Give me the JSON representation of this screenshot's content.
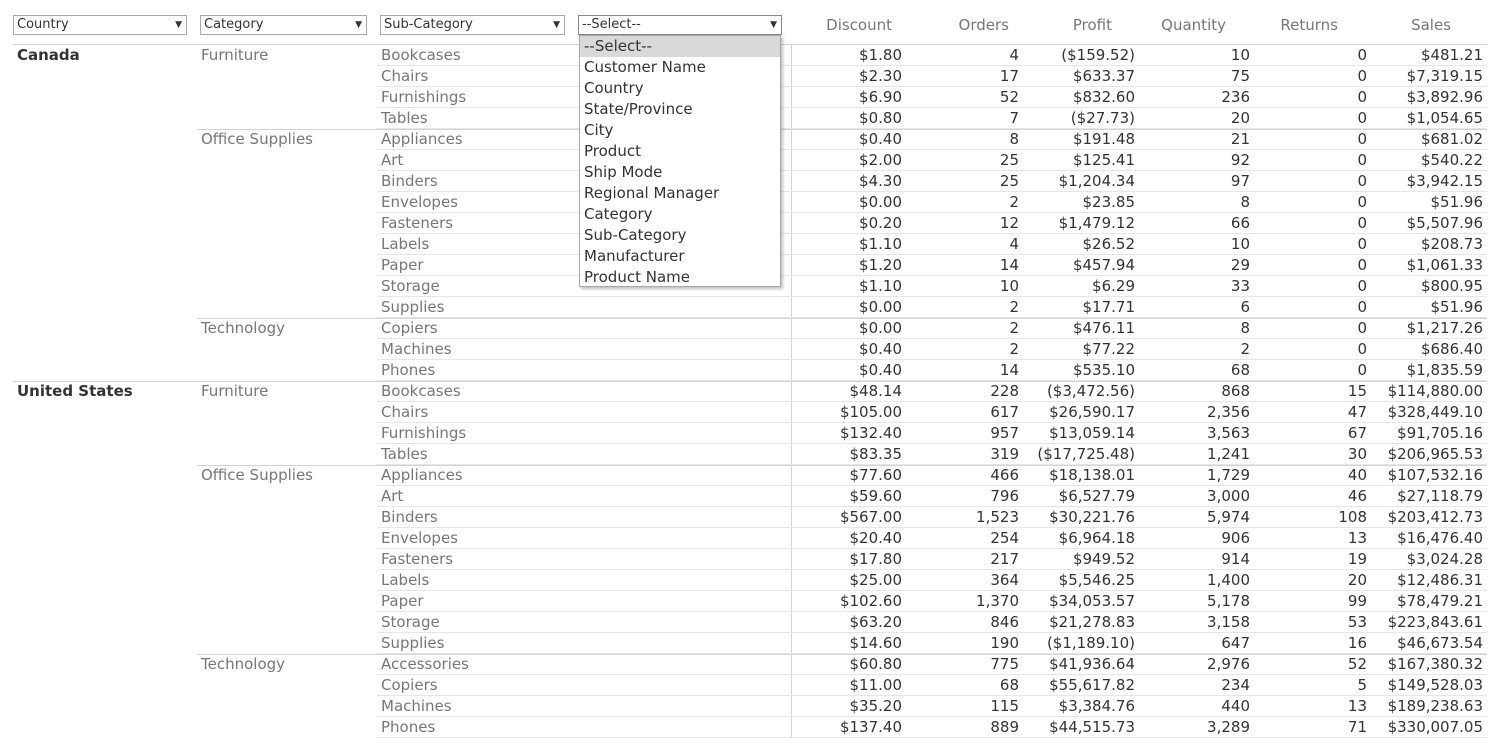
{
  "filters": {
    "country": "Country",
    "category": "Category",
    "sub_category": "Sub-Category",
    "dimension": "--Select--"
  },
  "dropdown_options": [
    "--Select--",
    "Customer Name",
    "Country",
    "State/Province",
    "City",
    "Product",
    "Ship Mode",
    "Regional Manager",
    "Category",
    "Sub-Category",
    "Manufacturer",
    "Product Name"
  ],
  "columns": [
    "Discount",
    "Orders",
    "Profit",
    "Quantity",
    "Returns",
    "Sales"
  ],
  "rows": [
    {
      "country": "Canada",
      "category": "Furniture",
      "sub": "Bookcases",
      "discount": "$1.80",
      "orders": "4",
      "profit": "($159.52)",
      "quantity": "10",
      "returns": "0",
      "sales": "$481.21"
    },
    {
      "country": "",
      "category": "",
      "sub": "Chairs",
      "discount": "$2.30",
      "orders": "17",
      "profit": "$633.37",
      "quantity": "75",
      "returns": "0",
      "sales": "$7,319.15"
    },
    {
      "country": "",
      "category": "",
      "sub": "Furnishings",
      "discount": "$6.90",
      "orders": "52",
      "profit": "$832.60",
      "quantity": "236",
      "returns": "0",
      "sales": "$3,892.96"
    },
    {
      "country": "",
      "category": "",
      "sub": "Tables",
      "discount": "$0.80",
      "orders": "7",
      "profit": "($27.73)",
      "quantity": "20",
      "returns": "0",
      "sales": "$1,054.65"
    },
    {
      "country": "",
      "category": "Office Supplies",
      "sub": "Appliances",
      "discount": "$0.40",
      "orders": "8",
      "profit": "$191.48",
      "quantity": "21",
      "returns": "0",
      "sales": "$681.02"
    },
    {
      "country": "",
      "category": "",
      "sub": "Art",
      "discount": "$2.00",
      "orders": "25",
      "profit": "$125.41",
      "quantity": "92",
      "returns": "0",
      "sales": "$540.22"
    },
    {
      "country": "",
      "category": "",
      "sub": "Binders",
      "discount": "$4.30",
      "orders": "25",
      "profit": "$1,204.34",
      "quantity": "97",
      "returns": "0",
      "sales": "$3,942.15"
    },
    {
      "country": "",
      "category": "",
      "sub": "Envelopes",
      "discount": "$0.00",
      "orders": "2",
      "profit": "$23.85",
      "quantity": "8",
      "returns": "0",
      "sales": "$51.96"
    },
    {
      "country": "",
      "category": "",
      "sub": "Fasteners",
      "discount": "$0.20",
      "orders": "12",
      "profit": "$1,479.12",
      "quantity": "66",
      "returns": "0",
      "sales": "$5,507.96"
    },
    {
      "country": "",
      "category": "",
      "sub": "Labels",
      "discount": "$1.10",
      "orders": "4",
      "profit": "$26.52",
      "quantity": "10",
      "returns": "0",
      "sales": "$208.73"
    },
    {
      "country": "",
      "category": "",
      "sub": "Paper",
      "discount": "$1.20",
      "orders": "14",
      "profit": "$457.94",
      "quantity": "29",
      "returns": "0",
      "sales": "$1,061.33"
    },
    {
      "country": "",
      "category": "",
      "sub": "Storage",
      "discount": "$1.10",
      "orders": "10",
      "profit": "$6.29",
      "quantity": "33",
      "returns": "0",
      "sales": "$800.95"
    },
    {
      "country": "",
      "category": "",
      "sub": "Supplies",
      "discount": "$0.00",
      "orders": "2",
      "profit": "$17.71",
      "quantity": "6",
      "returns": "0",
      "sales": "$51.96"
    },
    {
      "country": "",
      "category": "Technology",
      "sub": "Copiers",
      "discount": "$0.00",
      "orders": "2",
      "profit": "$476.11",
      "quantity": "8",
      "returns": "0",
      "sales": "$1,217.26"
    },
    {
      "country": "",
      "category": "",
      "sub": "Machines",
      "discount": "$0.40",
      "orders": "2",
      "profit": "$77.22",
      "quantity": "2",
      "returns": "0",
      "sales": "$686.40"
    },
    {
      "country": "",
      "category": "",
      "sub": "Phones",
      "discount": "$0.40",
      "orders": "14",
      "profit": "$535.10",
      "quantity": "68",
      "returns": "0",
      "sales": "$1,835.59"
    },
    {
      "country": "United States",
      "category": "Furniture",
      "sub": "Bookcases",
      "discount": "$48.14",
      "orders": "228",
      "profit": "($3,472.56)",
      "quantity": "868",
      "returns": "15",
      "sales": "$114,880.00"
    },
    {
      "country": "",
      "category": "",
      "sub": "Chairs",
      "discount": "$105.00",
      "orders": "617",
      "profit": "$26,590.17",
      "quantity": "2,356",
      "returns": "47",
      "sales": "$328,449.10"
    },
    {
      "country": "",
      "category": "",
      "sub": "Furnishings",
      "discount": "$132.40",
      "orders": "957",
      "profit": "$13,059.14",
      "quantity": "3,563",
      "returns": "67",
      "sales": "$91,705.16"
    },
    {
      "country": "",
      "category": "",
      "sub": "Tables",
      "discount": "$83.35",
      "orders": "319",
      "profit": "($17,725.48)",
      "quantity": "1,241",
      "returns": "30",
      "sales": "$206,965.53"
    },
    {
      "country": "",
      "category": "Office Supplies",
      "sub": "Appliances",
      "discount": "$77.60",
      "orders": "466",
      "profit": "$18,138.01",
      "quantity": "1,729",
      "returns": "40",
      "sales": "$107,532.16"
    },
    {
      "country": "",
      "category": "",
      "sub": "Art",
      "discount": "$59.60",
      "orders": "796",
      "profit": "$6,527.79",
      "quantity": "3,000",
      "returns": "46",
      "sales": "$27,118.79"
    },
    {
      "country": "",
      "category": "",
      "sub": "Binders",
      "discount": "$567.00",
      "orders": "1,523",
      "profit": "$30,221.76",
      "quantity": "5,974",
      "returns": "108",
      "sales": "$203,412.73"
    },
    {
      "country": "",
      "category": "",
      "sub": "Envelopes",
      "discount": "$20.40",
      "orders": "254",
      "profit": "$6,964.18",
      "quantity": "906",
      "returns": "13",
      "sales": "$16,476.40"
    },
    {
      "country": "",
      "category": "",
      "sub": "Fasteners",
      "discount": "$17.80",
      "orders": "217",
      "profit": "$949.52",
      "quantity": "914",
      "returns": "19",
      "sales": "$3,024.28"
    },
    {
      "country": "",
      "category": "",
      "sub": "Labels",
      "discount": "$25.00",
      "orders": "364",
      "profit": "$5,546.25",
      "quantity": "1,400",
      "returns": "20",
      "sales": "$12,486.31"
    },
    {
      "country": "",
      "category": "",
      "sub": "Paper",
      "discount": "$102.60",
      "orders": "1,370",
      "profit": "$34,053.57",
      "quantity": "5,178",
      "returns": "99",
      "sales": "$78,479.21"
    },
    {
      "country": "",
      "category": "",
      "sub": "Storage",
      "discount": "$63.20",
      "orders": "846",
      "profit": "$21,278.83",
      "quantity": "3,158",
      "returns": "53",
      "sales": "$223,843.61"
    },
    {
      "country": "",
      "category": "",
      "sub": "Supplies",
      "discount": "$14.60",
      "orders": "190",
      "profit": "($1,189.10)",
      "quantity": "647",
      "returns": "16",
      "sales": "$46,673.54"
    },
    {
      "country": "",
      "category": "Technology",
      "sub": "Accessories",
      "discount": "$60.80",
      "orders": "775",
      "profit": "$41,936.64",
      "quantity": "2,976",
      "returns": "52",
      "sales": "$167,380.32"
    },
    {
      "country": "",
      "category": "",
      "sub": "Copiers",
      "discount": "$11.00",
      "orders": "68",
      "profit": "$55,617.82",
      "quantity": "234",
      "returns": "5",
      "sales": "$149,528.03"
    },
    {
      "country": "",
      "category": "",
      "sub": "Machines",
      "discount": "$35.20",
      "orders": "115",
      "profit": "$3,384.76",
      "quantity": "440",
      "returns": "13",
      "sales": "$189,238.63"
    },
    {
      "country": "",
      "category": "",
      "sub": "Phones",
      "discount": "$137.40",
      "orders": "889",
      "profit": "$44,515.73",
      "quantity": "3,289",
      "returns": "71",
      "sales": "$330,007.05"
    }
  ]
}
